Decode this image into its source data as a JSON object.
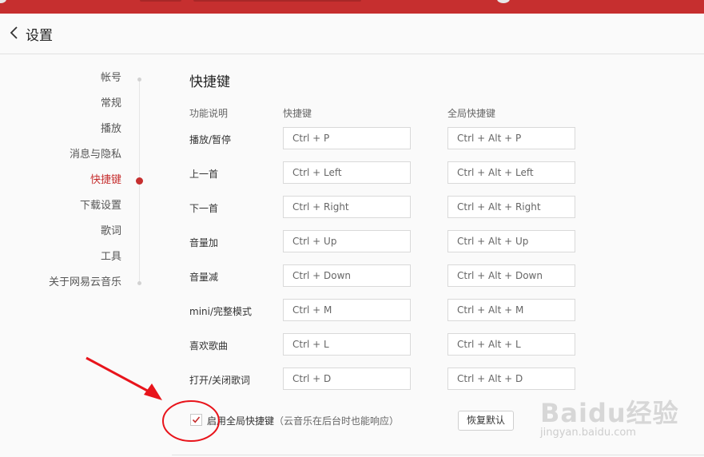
{
  "header": {
    "title": "设置"
  },
  "sidebar": {
    "items": [
      {
        "label": "帐号"
      },
      {
        "label": "常规"
      },
      {
        "label": "播放"
      },
      {
        "label": "消息与隐私"
      },
      {
        "label": "快捷键"
      },
      {
        "label": "下载设置"
      },
      {
        "label": "歌词"
      },
      {
        "label": "工具"
      },
      {
        "label": "关于网易云音乐"
      }
    ],
    "active": "快捷键"
  },
  "shortcuts": {
    "title": "快捷键",
    "columns": [
      "功能说明",
      "快捷键",
      "全局快捷键"
    ],
    "rows": [
      {
        "name": "播放/暂停",
        "key": "Ctrl + P",
        "global": "Ctrl + Alt + P"
      },
      {
        "name": "上一首",
        "key": "Ctrl + Left",
        "global": "Ctrl + Alt + Left"
      },
      {
        "name": "下一首",
        "key": "Ctrl + Right",
        "global": "Ctrl + Alt + Right"
      },
      {
        "name": "音量加",
        "key": "Ctrl + Up",
        "global": "Ctrl + Alt + Up"
      },
      {
        "name": "音量减",
        "key": "Ctrl + Down",
        "global": "Ctrl + Alt + Down"
      },
      {
        "name": "mini/完整模式",
        "key": "Ctrl + M",
        "global": "Ctrl + Alt + M"
      },
      {
        "name": "喜欢歌曲",
        "key": "Ctrl + L",
        "global": "Ctrl + Alt + L"
      },
      {
        "name": "打开/关闭歌词",
        "key": "Ctrl + D",
        "global": "Ctrl + Alt + D"
      }
    ],
    "enable_global": {
      "checked": true,
      "label": "启用全局快捷键",
      "note": "（云音乐在后台时也能响应）"
    },
    "reset_label": "恢复默认"
  },
  "watermark": {
    "brand": "Baidu经验",
    "sub": "jingyan.baidu.com"
  },
  "colors": {
    "brand_red": "#c62f2f",
    "annotation_red": "#e8141b"
  }
}
